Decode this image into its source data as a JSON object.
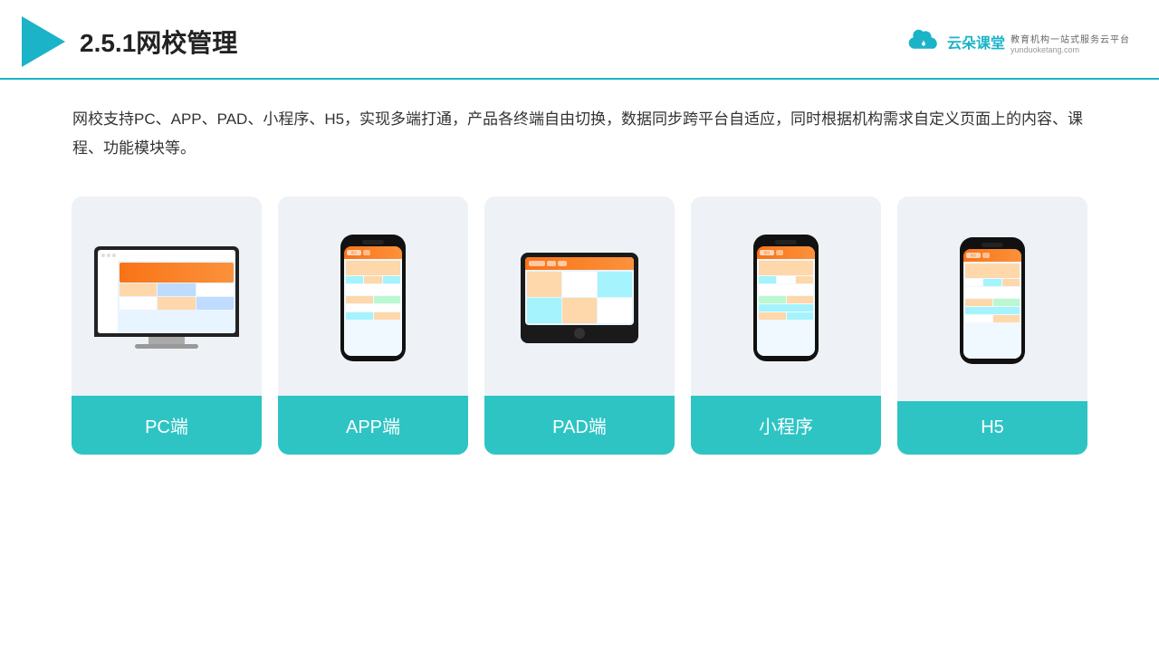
{
  "header": {
    "title": "2.5.1网校管理",
    "brand": {
      "name": "云朵课堂",
      "url": "yunduoketang.com",
      "tagline": "教育机构一站式服务云平台"
    }
  },
  "description": {
    "text": "网校支持PC、APP、PAD、小程序、H5，实现多端打通，产品各终端自由切换，数据同步跨平台自适应，同时根据机构需求自定义页面上的内容、课程、功能模块等。"
  },
  "cards": [
    {
      "label": "PC端",
      "type": "pc"
    },
    {
      "label": "APP端",
      "type": "phone"
    },
    {
      "label": "PAD端",
      "type": "tablet"
    },
    {
      "label": "小程序",
      "type": "phone2"
    },
    {
      "label": "H5",
      "type": "phone3"
    }
  ]
}
